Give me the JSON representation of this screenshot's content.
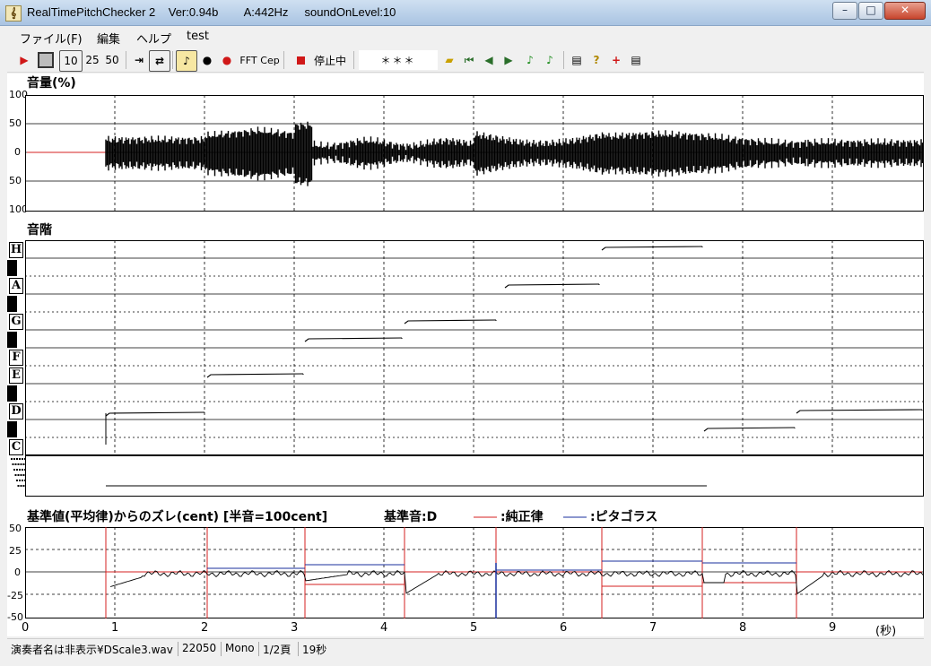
{
  "window": {
    "title": "RealTimePitchChecker 2    Ver:0.94b        A:442Hz     soundOnLevel:10",
    "minimize": "–",
    "maximize": "□",
    "close": "✕"
  },
  "menu": [
    {
      "label": "ファイル(F)"
    },
    {
      "label": "編集"
    },
    {
      "label": "ヘルプ"
    },
    {
      "label": "test"
    }
  ],
  "toolbar": {
    "zoom_10": "10",
    "zoom_25": "25",
    "zoom_50": "50",
    "fft": "FFT",
    "cep": "Cep",
    "status": "停止中",
    "note_display": "＊＊＊"
  },
  "volume_panel": {
    "title": "音量(%)",
    "y_labels": [
      "100",
      "50",
      "0",
      "50",
      "100"
    ]
  },
  "pitch_panel": {
    "title": "音階",
    "notes": [
      "H",
      "A",
      "G",
      "F",
      "E",
      "D",
      "C"
    ]
  },
  "deviation_panel": {
    "title": "基準値(平均律)からのズレ(cent) [半音=100cent]",
    "base_note": "基準音:D",
    "legend_just": ":純正律",
    "legend_pyth": ":ピタゴラス",
    "y_labels": [
      "50",
      "25",
      "0",
      "-25",
      "-50"
    ],
    "x_labels": [
      "0",
      "1",
      "2",
      "3",
      "4",
      "5",
      "6",
      "7",
      "8",
      "9"
    ],
    "x_unit": "(秒)",
    "colors": {
      "just": "#d42020",
      "pyth": "#1a2f9e"
    }
  },
  "status": {
    "file": "演奏者名は非表示¥DScale3.wav",
    "rate": "22050",
    "channels": "Mono",
    "page": "1/2頁",
    "duration": "19秒"
  }
}
